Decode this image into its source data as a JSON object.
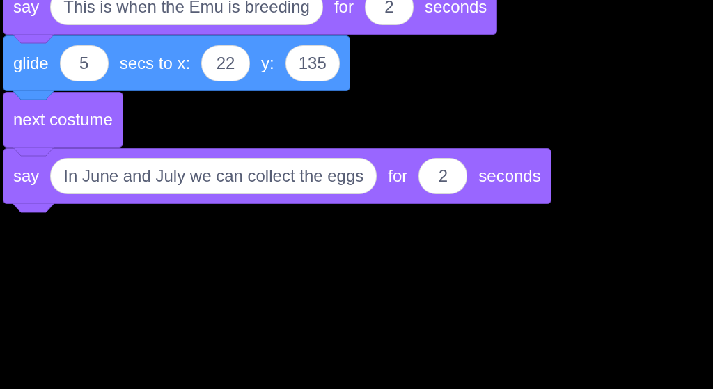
{
  "blocks": [
    {
      "kind": "looks",
      "parts": [
        {
          "kind": "label",
          "text": "say"
        },
        {
          "kind": "input",
          "text": "This is when the Emu is breeding"
        },
        {
          "kind": "label",
          "text": "for"
        },
        {
          "kind": "input",
          "text": "2"
        },
        {
          "kind": "label",
          "text": "seconds"
        }
      ]
    },
    {
      "kind": "motion",
      "parts": [
        {
          "kind": "label",
          "text": "glide"
        },
        {
          "kind": "input",
          "text": "5"
        },
        {
          "kind": "label",
          "text": "secs to x:"
        },
        {
          "kind": "input",
          "text": "22"
        },
        {
          "kind": "label",
          "text": "y:"
        },
        {
          "kind": "input",
          "text": "135"
        }
      ]
    },
    {
      "kind": "looks",
      "parts": [
        {
          "kind": "label",
          "text": "next costume"
        }
      ]
    },
    {
      "kind": "looks",
      "parts": [
        {
          "kind": "label",
          "text": "say"
        },
        {
          "kind": "input",
          "text": "In June and July we can collect the eggs"
        },
        {
          "kind": "label",
          "text": "for"
        },
        {
          "kind": "input",
          "text": "2"
        },
        {
          "kind": "label",
          "text": "seconds"
        }
      ]
    }
  ]
}
